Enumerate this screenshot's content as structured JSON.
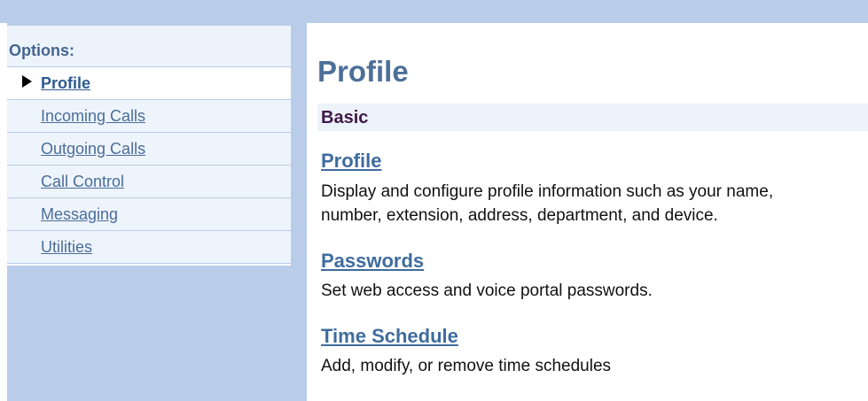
{
  "sidebar": {
    "title": "Options:",
    "items": [
      {
        "label": "Profile",
        "active": true
      },
      {
        "label": "Incoming Calls",
        "active": false
      },
      {
        "label": "Outgoing Calls",
        "active": false
      },
      {
        "label": "Call Control",
        "active": false
      },
      {
        "label": "Messaging",
        "active": false
      },
      {
        "label": "Utilities",
        "active": false
      }
    ]
  },
  "main": {
    "title": "Profile",
    "section": {
      "title": "Basic",
      "items": [
        {
          "label": "Profile",
          "description_lines": [
            "Display and configure profile information such as your name,",
            "number, extension, address, department, and device."
          ]
        },
        {
          "label": "Passwords",
          "description_lines": [
            "Set web access and voice portal passwords."
          ]
        },
        {
          "label": "Time Schedule",
          "description_lines": [
            "Add, modify, or remove time schedules"
          ]
        }
      ]
    }
  },
  "colors": {
    "frame_blue": "#b9cde9",
    "sidebar_pale": "#eef4fb",
    "link_blue": "#3f6c9e",
    "title_blue": "#4c6f98",
    "section_title": "#3f1848"
  },
  "icons": {
    "active_indicator": "triangle-right-icon"
  }
}
